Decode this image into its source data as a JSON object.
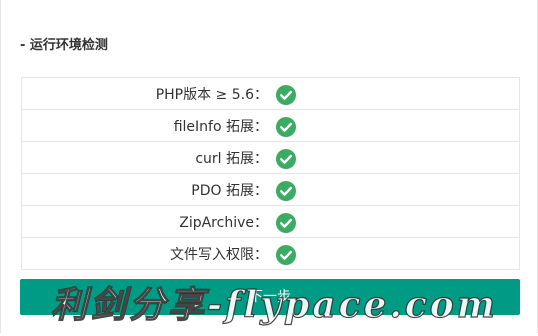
{
  "section": {
    "title": "- 运行环境检测"
  },
  "checks": [
    {
      "label": "PHP版本 ≥ 5.6：",
      "status": "passed",
      "icon": "check-circle-icon"
    },
    {
      "label": "fileInfo 拓展：",
      "status": "passed",
      "icon": "check-circle-icon"
    },
    {
      "label": "curl 拓展：",
      "status": "passed",
      "icon": "check-circle-icon"
    },
    {
      "label": "PDO 拓展：",
      "status": "passed",
      "icon": "check-circle-icon"
    },
    {
      "label": "ZipArchive：",
      "status": "passed",
      "icon": "check-circle-icon"
    },
    {
      "label": "文件写入权限：",
      "status": "passed",
      "icon": "check-circle-icon"
    }
  ],
  "next_button": {
    "label": "下一步"
  },
  "watermark": {
    "text": "利剑分享-flypace.com"
  },
  "colors": {
    "accent": "#009b84",
    "check": "#3cab63",
    "border": "#e6e6e6",
    "text": "#333333"
  }
}
